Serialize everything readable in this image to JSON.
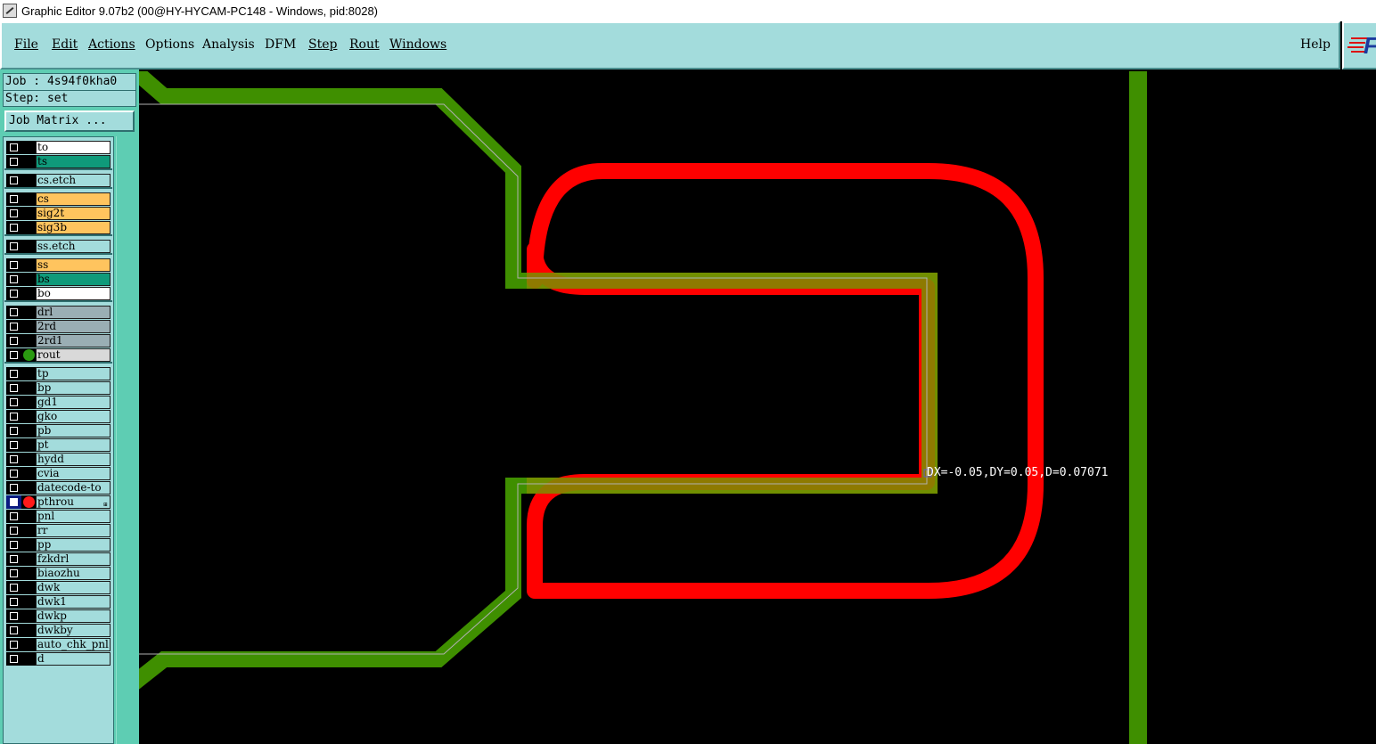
{
  "window": {
    "title": "Graphic Editor 9.07b2 (00@HY-HYCAM-PC148 - Windows, pid:8028)"
  },
  "menu": {
    "items": [
      "File",
      "Edit",
      "Actions",
      "Options",
      "Analysis",
      "DFM",
      "Step",
      "Rout",
      "Windows"
    ],
    "help": "Help"
  },
  "job": {
    "job_line": "Job : 4s94f0kha0",
    "step_line": "Step: set",
    "matrix_button": "Job Matrix ..."
  },
  "colors": {
    "background": "#000000",
    "panel": "#a3dcdc",
    "panel_dark": "#5ecdb3",
    "rout_green": "#3f8f00",
    "pthrou_red": "#ff0000"
  },
  "layers": [
    {
      "name": "to",
      "color": "#ffffff"
    },
    {
      "name": "ts",
      "color": "#0f9a7a"
    },
    {
      "name": "cs.etch",
      "color": "#a3dcdc"
    },
    {
      "name": "cs",
      "color": "#ffc45e"
    },
    {
      "name": "sig2t",
      "color": "#ffc45e"
    },
    {
      "name": "sig3b",
      "color": "#ffc45e"
    },
    {
      "name": "ss.etch",
      "color": "#a3dcdc"
    },
    {
      "name": "ss",
      "color": "#ffc45e"
    },
    {
      "name": "bs",
      "color": "#0f9a7a"
    },
    {
      "name": "bo",
      "color": "#ffffff"
    },
    {
      "name": "drl",
      "color": "#9aaeb4"
    },
    {
      "name": "2rd",
      "color": "#9aaeb4"
    },
    {
      "name": "2rd1",
      "color": "#9aaeb4"
    },
    {
      "name": "rout",
      "color": "#d9d9d9",
      "dot": "#2a9a10"
    },
    {
      "name": "tp",
      "color": "#a3dcdc"
    },
    {
      "name": "bp",
      "color": "#a3dcdc"
    },
    {
      "name": "gd1",
      "color": "#a3dcdc"
    },
    {
      "name": "gko",
      "color": "#a3dcdc"
    },
    {
      "name": "pb",
      "color": "#a3dcdc"
    },
    {
      "name": "pt",
      "color": "#a3dcdc"
    },
    {
      "name": "hydd",
      "color": "#a3dcdc"
    },
    {
      "name": "cvia",
      "color": "#a3dcdc"
    },
    {
      "name": "datecode-to",
      "color": "#a3dcdc"
    },
    {
      "name": "pthrou",
      "color": "#a3dcdc",
      "dot": "#ff1a1a",
      "selected": true
    },
    {
      "name": "pnl",
      "color": "#a3dcdc"
    },
    {
      "name": "rr",
      "color": "#a3dcdc"
    },
    {
      "name": "pp",
      "color": "#a3dcdc"
    },
    {
      "name": "fzkdrl",
      "color": "#a3dcdc"
    },
    {
      "name": "biaozhu",
      "color": "#a3dcdc"
    },
    {
      "name": "dwk",
      "color": "#a3dcdc"
    },
    {
      "name": "dwk1",
      "color": "#a3dcdc"
    },
    {
      "name": "dwkp",
      "color": "#a3dcdc"
    },
    {
      "name": "dwkby",
      "color": "#a3dcdc"
    },
    {
      "name": "auto_chk_pnl",
      "color": "#a3dcdc"
    },
    {
      "name": "d",
      "color": "#a3dcdc"
    }
  ],
  "canvas": {
    "measurement": "DX=-0.05,DY=0.05,D=0.07071"
  }
}
